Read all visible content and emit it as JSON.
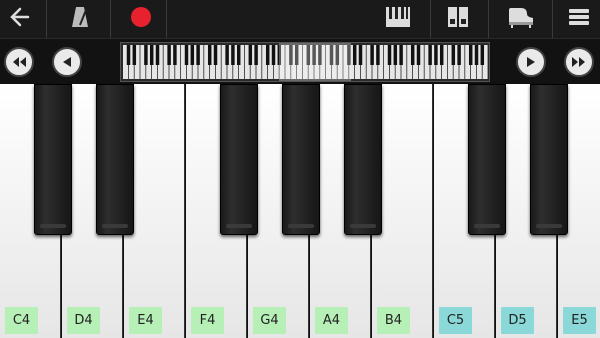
{
  "toolbar": {
    "back_icon": "back-arrow-icon",
    "metronome_icon": "metronome-icon",
    "record_icon": "record-icon",
    "record_color": "#e8212e",
    "keyboard_icon": "keyboard-layout-icon",
    "dual_icon": "dual-keyboard-icon",
    "instrument_icon": "grand-piano-icon",
    "menu_icon": "menu-icon"
  },
  "navigation": {
    "fast_left_icon": "double-chevron-left-icon",
    "left_icon": "play-left-icon",
    "right_icon": "play-right-icon",
    "fast_right_icon": "double-chevron-right-icon"
  },
  "keys": {
    "white": [
      "C4",
      "D4",
      "E4",
      "F4",
      "G4",
      "A4",
      "B4",
      "C5",
      "D5",
      "E5"
    ],
    "label_colors": {
      "octave4": "#b6f0b6",
      "octave5": "#8ad8d8"
    }
  }
}
